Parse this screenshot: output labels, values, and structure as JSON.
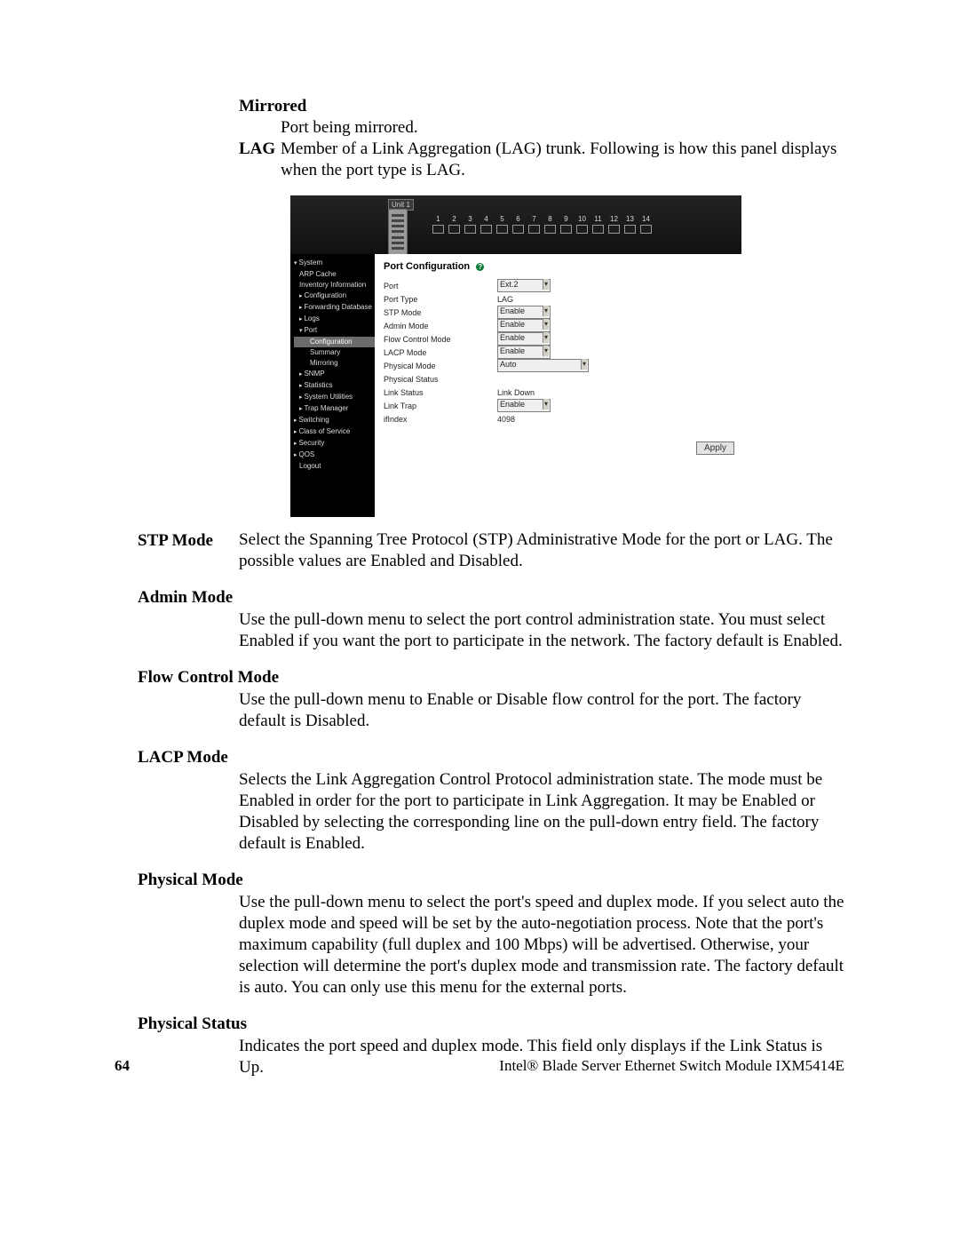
{
  "doc": {
    "mirrored": {
      "term": "Mirrored",
      "body": "Port being mirrored."
    },
    "lag": {
      "term": "LAG",
      "body": "Member of a Link Aggregation (LAG) trunk. Following is how this panel displays when the port type is LAG."
    },
    "sections": {
      "stp": {
        "term": "STP Mode",
        "body": "Select the Spanning Tree Protocol (STP) Administrative Mode for the port or LAG. The possible values are Enabled and Disabled."
      },
      "admin": {
        "term": "Admin Mode",
        "body": "Use the pull-down menu to select the port control administration state. You must select Enabled if you want the port to participate in the network. The factory default is Enabled."
      },
      "flow": {
        "term": "Flow Control Mode",
        "body": "Use the pull-down menu to Enable or Disable flow control for the port. The factory default is Disabled."
      },
      "lacp": {
        "term": "LACP Mode",
        "body": "Selects the Link Aggregation Control Protocol administration state. The mode must be Enabled in order for the port to participate in Link Aggregation. It may be Enabled or Disabled by selecting the corresponding line on the pull-down entry field. The factory default is Enabled."
      },
      "phymode": {
        "term": "Physical Mode",
        "body": "Use the pull-down menu to select the port's speed and duplex mode. If you select auto the duplex mode and speed will be set by the auto-negotiation process. Note that the port's maximum capability (full duplex and 100 Mbps) will be advertised. Otherwise, your selection will determine the port's duplex mode and transmission rate. The factory default is auto. You can only use this menu for the external ports."
      },
      "phystat": {
        "term": "Physical Status",
        "body": "Indicates the port speed and duplex mode. This field only displays if the Link Status is Up."
      }
    },
    "footer": {
      "page": "64",
      "title": "Intel® Blade Server Ethernet Switch Module IXM5414E"
    }
  },
  "shot": {
    "unit_label": "Unit 1",
    "port_nums": [
      "1",
      "2",
      "3",
      "4",
      "5",
      "6",
      "7",
      "8",
      "9",
      "10",
      "11",
      "12",
      "13",
      "14"
    ],
    "sidebar": [
      {
        "cls": "n exp",
        "txt": "System"
      },
      {
        "cls": "n ind1",
        "txt": "ARP Cache"
      },
      {
        "cls": "n ind1",
        "txt": "Inventory Information"
      },
      {
        "cls": "n col ind1",
        "txt": "Configuration"
      },
      {
        "cls": "n col ind1",
        "txt": "Forwarding Database"
      },
      {
        "cls": "n col ind1",
        "txt": "Logs"
      },
      {
        "cls": "n exp ind1",
        "txt": "Port"
      },
      {
        "cls": "n sel",
        "txt": "Configuration"
      },
      {
        "cls": "n ind3",
        "txt": "Summary"
      },
      {
        "cls": "n ind3",
        "txt": "Mirroring"
      },
      {
        "cls": "n col ind1",
        "txt": "SNMP"
      },
      {
        "cls": "n col ind1",
        "txt": "Statistics"
      },
      {
        "cls": "n col ind1",
        "txt": "System Utilities"
      },
      {
        "cls": "n col ind1",
        "txt": "Trap Manager"
      },
      {
        "cls": "n col",
        "txt": "Switching"
      },
      {
        "cls": "n col",
        "txt": "Class of Service"
      },
      {
        "cls": "n col",
        "txt": "Security"
      },
      {
        "cls": "n col",
        "txt": "QOS"
      },
      {
        "cls": "n ind1",
        "txt": "Logout"
      }
    ],
    "main": {
      "title": "Port Configuration",
      "help": "?",
      "rows": [
        {
          "label": "Port",
          "type": "select",
          "value": "Ext.2"
        },
        {
          "label": "Port Type",
          "type": "value",
          "value": "LAG"
        },
        {
          "label": "STP Mode",
          "type": "select",
          "value": "Enable"
        },
        {
          "label": "Admin Mode",
          "type": "select",
          "value": "Enable"
        },
        {
          "label": "Flow Control Mode",
          "type": "select",
          "value": "Enable"
        },
        {
          "label": "LACP Mode",
          "type": "select",
          "value": "Enable"
        },
        {
          "label": "Physical Mode",
          "type": "select",
          "value": "Auto",
          "wide": true
        },
        {
          "label": "Physical Status",
          "type": "value",
          "value": ""
        },
        {
          "label": "Link Status",
          "type": "value",
          "value": "Link Down"
        },
        {
          "label": "Link Trap",
          "type": "select",
          "value": "Enable"
        },
        {
          "label": "ifIndex",
          "type": "value",
          "value": "4098"
        }
      ],
      "apply": "Apply"
    }
  }
}
